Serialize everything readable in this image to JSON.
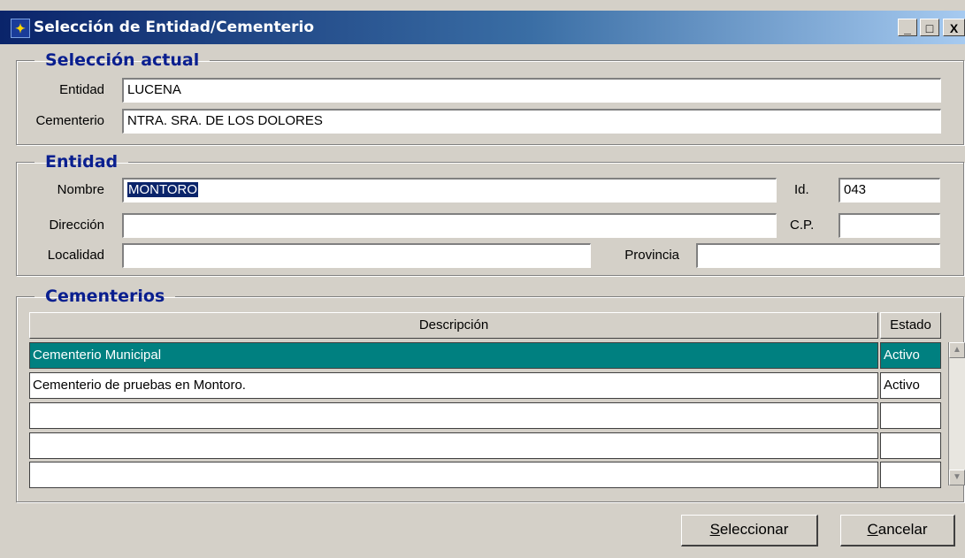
{
  "window": {
    "title": "Selección de Entidad/Cementerio",
    "buttons": {
      "minimize": "_",
      "maximize": "□",
      "close": "X"
    }
  },
  "seleccion_actual": {
    "legend": "Selección actual",
    "entidad_label": "Entidad",
    "entidad_value": "LUCENA",
    "cementerio_label": "Cementerio",
    "cementerio_value": "NTRA. SRA. DE LOS DOLORES"
  },
  "entidad": {
    "legend": "Entidad",
    "nombre_label": "Nombre",
    "nombre_value": "MONTORO",
    "id_label": "Id.",
    "id_value": "043",
    "direccion_label": "Dirección",
    "direccion_value": "",
    "cp_label": "C.P.",
    "cp_value": "",
    "localidad_label": "Localidad",
    "localidad_value": "",
    "provincia_label": "Provincia",
    "provincia_value": ""
  },
  "cementerios": {
    "legend": "Cementerios",
    "columns": [
      "Descripción",
      "Estado"
    ],
    "rows": [
      {
        "descripcion": "Cementerio Municipal",
        "estado": "Activo",
        "selected": true
      },
      {
        "descripcion": "Cementerio de pruebas en Montoro.",
        "estado": "Activo",
        "selected": false
      },
      {
        "descripcion": "",
        "estado": "",
        "selected": false
      },
      {
        "descripcion": "",
        "estado": "",
        "selected": false
      },
      {
        "descripcion": "",
        "estado": "",
        "selected": false
      }
    ]
  },
  "actions": {
    "select_first": "S",
    "select_rest": "eleccionar",
    "cancel_first": "C",
    "cancel_rest": "ancelar"
  },
  "colors": {
    "title_start": "#0a246a",
    "selected_row": "#008080",
    "legend": "#0a1f8f",
    "face": "#d4d0c8"
  }
}
